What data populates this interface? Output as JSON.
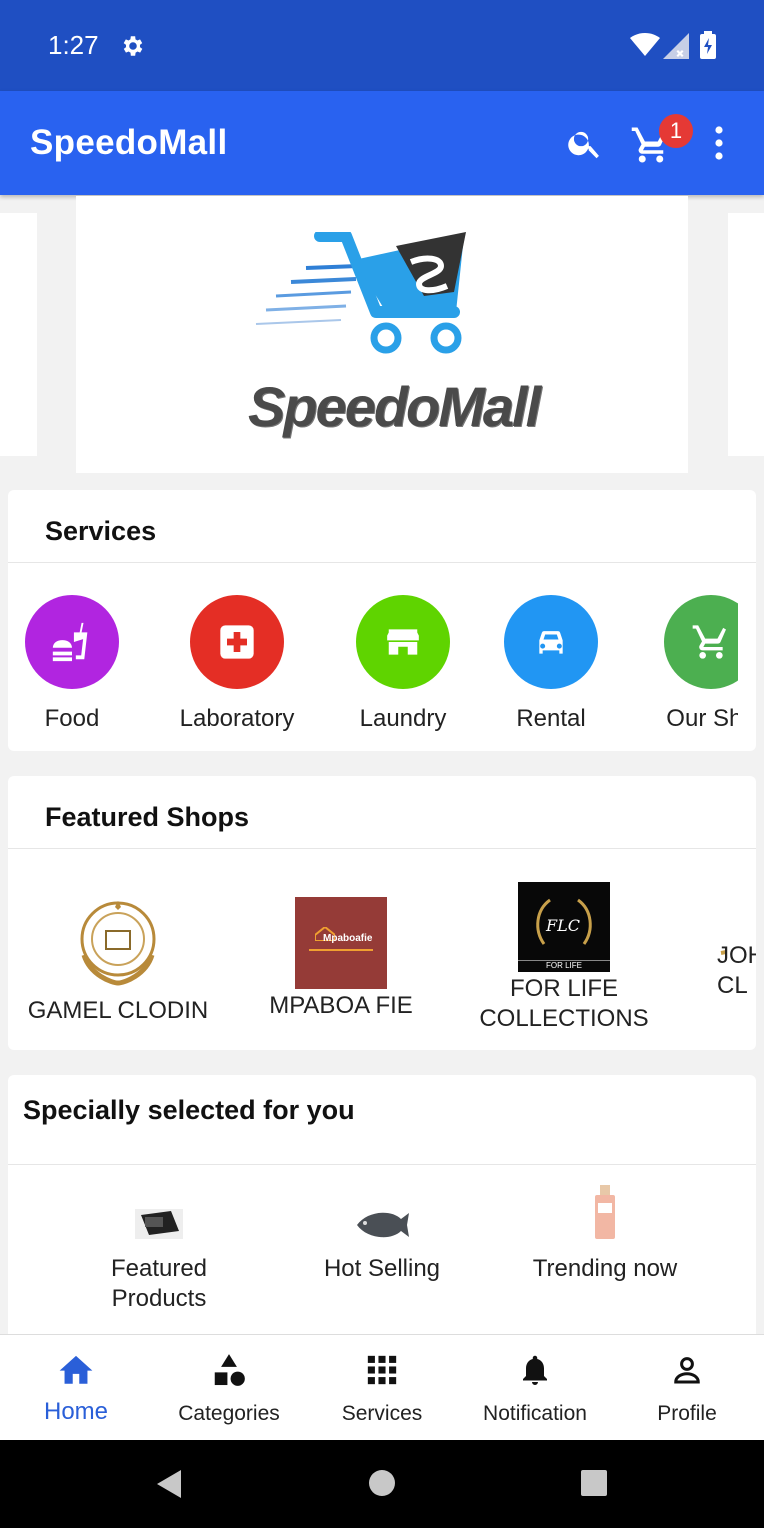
{
  "status_bar": {
    "time": "1:27"
  },
  "app_bar": {
    "title": "SpeedoMall",
    "cart_count": "1"
  },
  "banner": {
    "logo_text": "SpeedoMall"
  },
  "services": {
    "title": "Services",
    "items": [
      {
        "label": "Food",
        "icon": "fastfood-icon",
        "color": "#b125e0"
      },
      {
        "label": "Laboratory",
        "icon": "medical-icon",
        "color": "#e42e25"
      },
      {
        "label": "Laundry",
        "icon": "store-icon",
        "color": "#5fd400"
      },
      {
        "label": "Rental",
        "icon": "car-icon",
        "color": "#2196f3"
      },
      {
        "label": "Our Sho",
        "icon": "cart-icon",
        "color": "#4caf50"
      }
    ]
  },
  "featured_shops": {
    "title": "Featured Shops",
    "items": [
      {
        "label": "GAMEL CLODIN"
      },
      {
        "label": "MPABOA FIE",
        "logo_text": "Mpaboafie"
      },
      {
        "label": "FOR LIFE COLLECTIONS",
        "logo_text": "FLC",
        "logo_caption": "FOR LIFE"
      },
      {
        "label": "JOH CL"
      }
    ]
  },
  "special": {
    "title": "Specially selected for you",
    "items": [
      {
        "label": "Featured Products"
      },
      {
        "label": "Hot Selling"
      },
      {
        "label": "Trending now"
      }
    ]
  },
  "bottom_nav": {
    "items": [
      {
        "label": "Home",
        "icon": "home-icon"
      },
      {
        "label": "Categories",
        "icon": "shapes-icon"
      },
      {
        "label": "Services",
        "icon": "grid-icon"
      },
      {
        "label": "Notification",
        "icon": "bell-icon"
      },
      {
        "label": "Profile",
        "icon": "person-icon"
      }
    ],
    "active_color": "#2a5fd8"
  },
  "colors": {
    "status_bar": "#1f4fc2",
    "app_bar": "#2962f0",
    "badge": "#e53935"
  }
}
